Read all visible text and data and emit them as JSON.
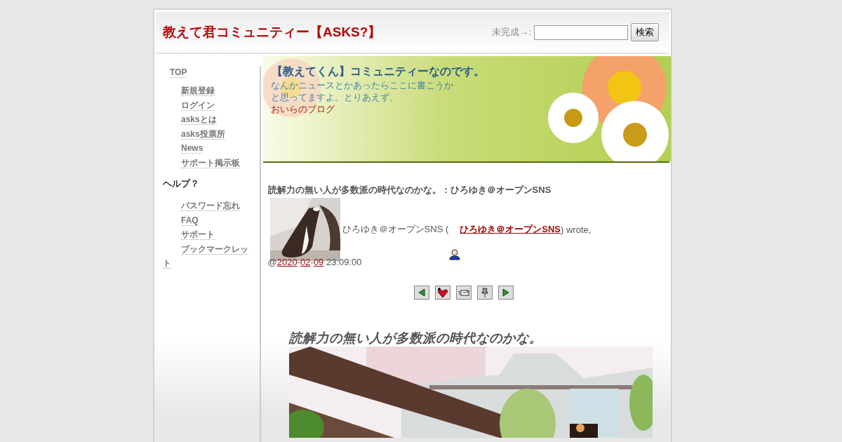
{
  "site": {
    "title": "教えて君コミュニティー【ASKS?】",
    "search_label": "未完成→:",
    "search_button": "検索"
  },
  "sidebar": {
    "top": "TOP",
    "items": [
      "新規登録",
      "ログイン",
      "asksとは",
      "asks投票所",
      "News",
      "サポート掲示板"
    ],
    "help_heading": "ヘルプ？",
    "help_items": [
      "パスワード忘れ",
      "FAQ",
      "サポート",
      "ブックマークレット"
    ]
  },
  "banner": {
    "title": "【教えてくん】コミュニティーなのです。",
    "text": "なんかニュースとかあったらここに書こうかと思ってますよ。とりあえず、",
    "link": "おいらのブログ"
  },
  "post": {
    "heading": "読解力の無い人が多数派の時代なのかな。：ひろゆき＠オープンSNS",
    "author_text": "ひろゆき＠オープンSNS (",
    "author_link": "ひろゆき＠オープンSNS",
    "wrote": ") wrote,",
    "at": "@",
    "date_parts": [
      {
        "text": "2020",
        "kind": "link"
      },
      {
        "text": "-",
        "kind": "plain"
      },
      {
        "text": "02",
        "kind": "link"
      },
      {
        "text": "-",
        "kind": "plain"
      },
      {
        "text": "09",
        "kind": "link"
      },
      {
        "text": " 23:09:00",
        "kind": "plain"
      }
    ],
    "tools": [
      {
        "kind": "prev"
      },
      {
        "kind": "favorite"
      },
      {
        "kind": "message"
      },
      {
        "kind": "pin"
      },
      {
        "kind": "next"
      }
    ],
    "body_title": "読解力の無い人が多数派の時代なのかな。"
  }
}
